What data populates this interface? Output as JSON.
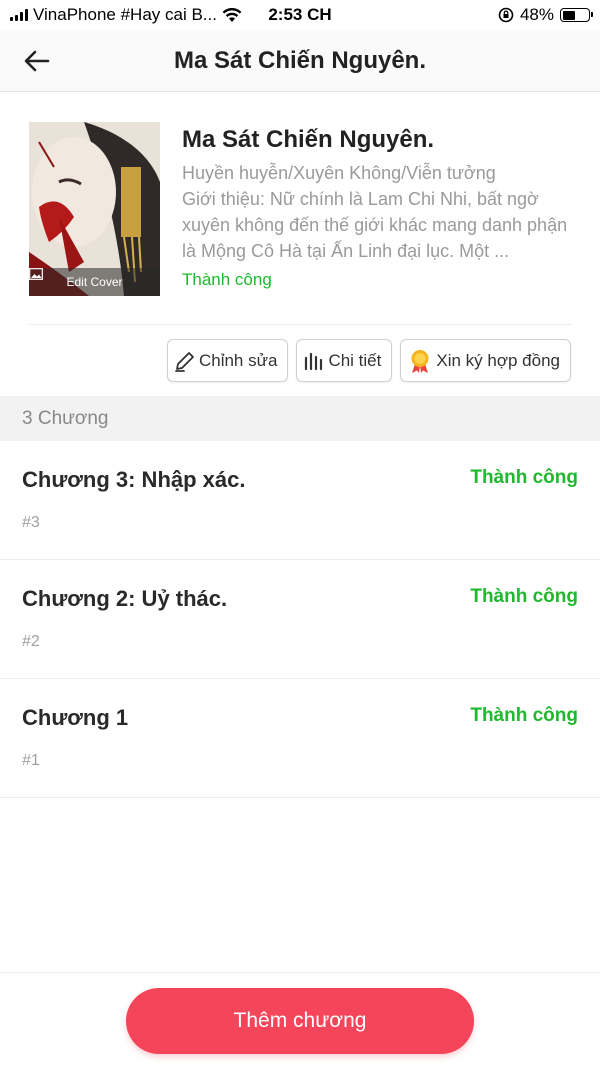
{
  "status_bar": {
    "carrier": "VinaPhone #Hay cai B...",
    "time": "2:53 CH",
    "battery": "48%",
    "battery_level": 0.48
  },
  "nav": {
    "title": "Ma Sát Chiến Nguyên.",
    "back_icon": "arrow-left-icon"
  },
  "book": {
    "title": "Ma Sát Chiến Nguyên.",
    "genre": "Huyền huyễn/Xuyên Không/Viễn tưởng",
    "intro": "Giới thiệu: Nữ chính là Lam Chi Nhi, bất ngờ xuyên không đến thế giới khác mang danh phận là Mộng Cô Hà tại Ấn Linh đại lục. Một ...",
    "status": "Thành công",
    "edit_cover_label": "Edit Cover"
  },
  "actions": {
    "edit_label": "Chỉnh sửa",
    "detail_label": "Chi tiết",
    "contract_label": "Xin ký hợp đồng"
  },
  "chapters": {
    "count_label": "3 Chương",
    "items": [
      {
        "title": "Chương 3: Nhập xác.",
        "status": "Thành công",
        "number": "#3"
      },
      {
        "title": "Chương 2: Uỷ thác.",
        "status": "Thành công",
        "number": "#2"
      },
      {
        "title": "Chương 1",
        "status": "Thành công",
        "number": "#1"
      }
    ]
  },
  "bottom": {
    "add_chapter_label": "Thêm chương"
  },
  "colors": {
    "accent": "#f5455a",
    "success": "#1fb82e"
  }
}
